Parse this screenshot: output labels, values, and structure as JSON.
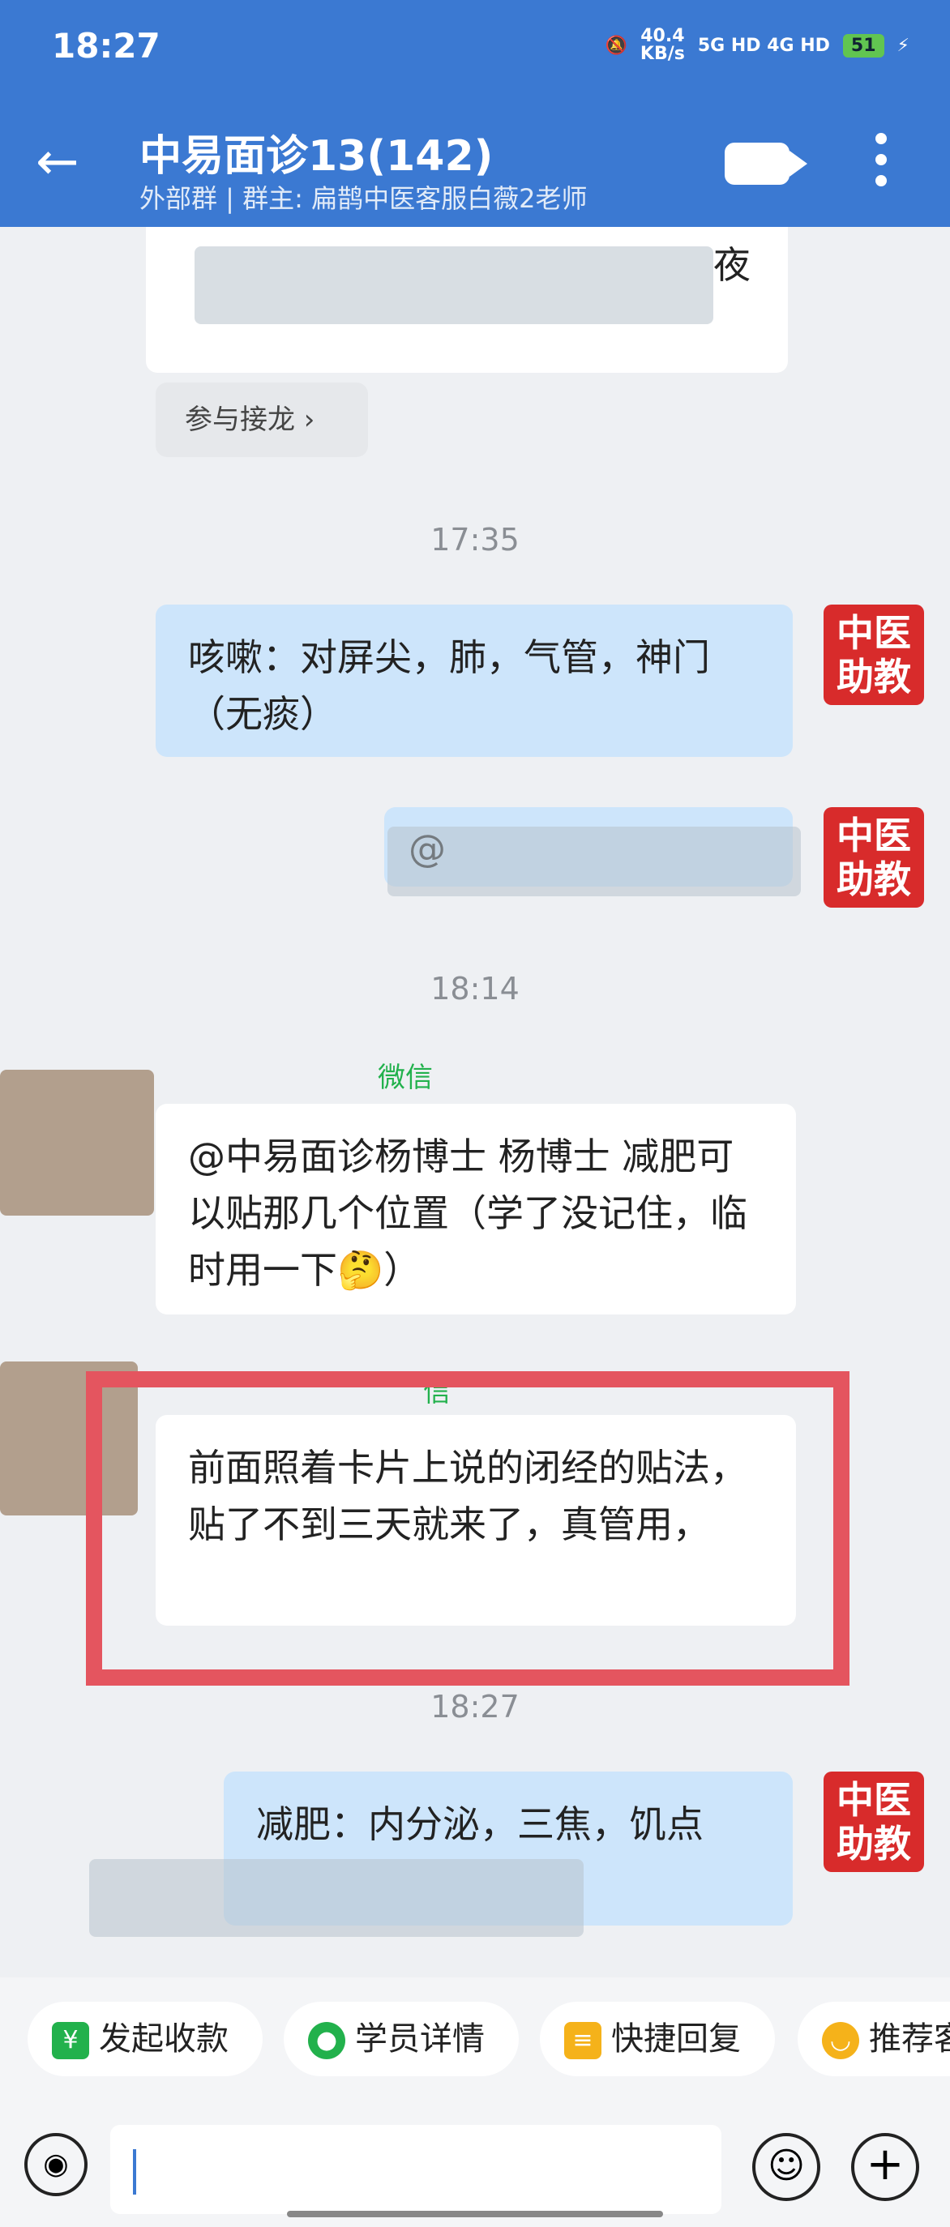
{
  "status": {
    "time": "18:27",
    "speed_value": "40.4",
    "speed_unit": "KB/s",
    "network": "5G HD  4G HD",
    "battery": "51"
  },
  "header": {
    "title": "中易面诊13(142)",
    "subtitle": "外部群  |  群主: 扁鹊中医客服白薇2老师",
    "back_icon": "←"
  },
  "chat": {
    "partial_top_text": "夜",
    "jielong_label": "参与接龙 ›",
    "times": [
      "17:35",
      "18:14",
      "18:27"
    ],
    "tcm_avatar_label": "中医\n助教",
    "msg1": "咳嗽：对屏尖，肺，气管，神门（无痰）",
    "msg2_partial": "@",
    "sender1_partial": "微信",
    "msg3": "@中易面诊杨博士 杨博士 减肥可以贴那几个位置（学了没记住，临时用一下🤔）",
    "sender2_partial": "信",
    "msg4": "前面照着卡片上说的闭经的贴法，贴了不到三天就来了，真管用，",
    "msg5": "减肥：内分泌，三焦，饥点"
  },
  "quick_actions": [
    {
      "label": "发起收款",
      "icon": "¥",
      "color": "#22b14c"
    },
    {
      "label": "学员详情",
      "icon": "●",
      "color": "#22b14c"
    },
    {
      "label": "快捷回复",
      "icon": "≡",
      "color": "#f5b21a"
    },
    {
      "label": "推荐客",
      "icon": "◡",
      "color": "#f5b21a"
    }
  ],
  "input": {
    "voice_icon": "◉",
    "emoji_icon": "☺",
    "plus_icon": "+"
  }
}
